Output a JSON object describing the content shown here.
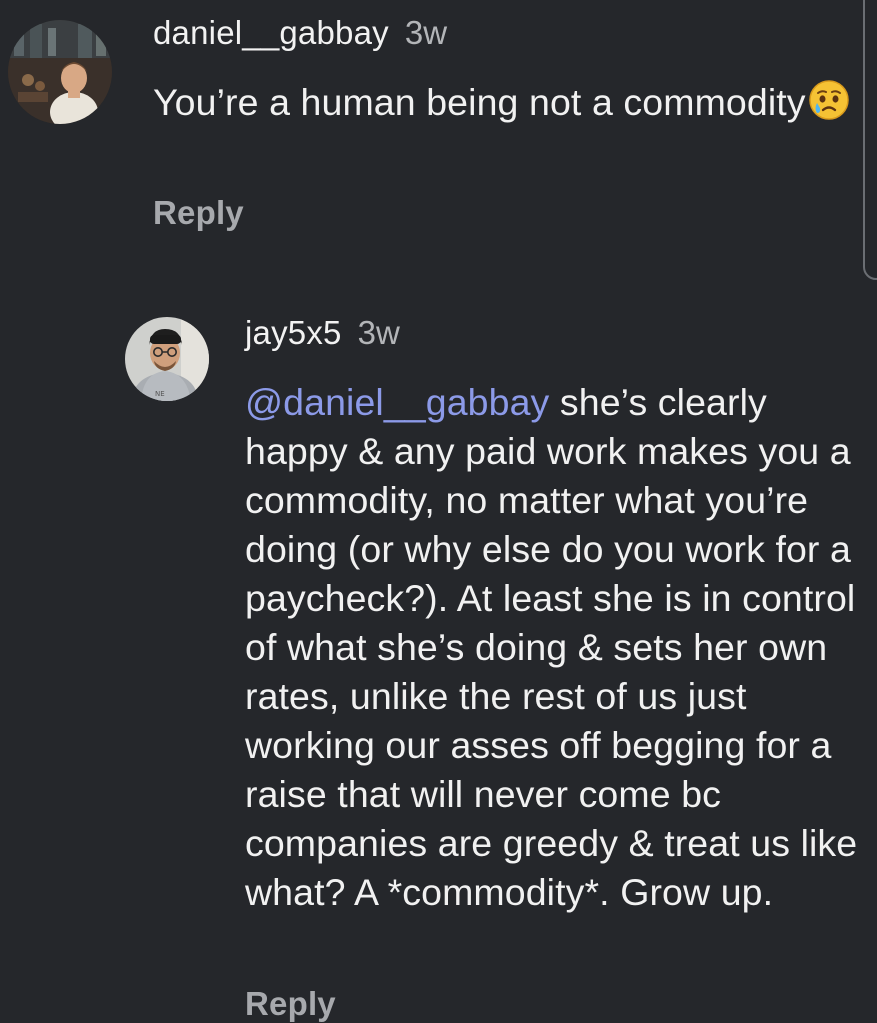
{
  "comments": [
    {
      "username": "daniel__gabbay",
      "time": "3w",
      "text": "You’re a human being not a commodity",
      "emoji": "crying-face",
      "reply_label": "Reply",
      "avatar": "avatar-photo"
    },
    {
      "username": "jay5x5",
      "time": "3w",
      "mention": "@daniel__gabbay",
      "text": " she’s clearly happy & any paid work makes you a commodity, no matter what you’re doing (or why else do you work for a paycheck?). At least she is in control of what she’s doing & sets her own rates, unlike the rest of us just working our asses off begging for a raise that will never come bc companies are greedy & treat us like what? A *commodity*. Grow up.",
      "reply_label": "Reply",
      "avatar": "avatar-photo"
    }
  ],
  "colors": {
    "background": "#25272b",
    "text": "#f1f1f1",
    "muted": "#b3b5b8",
    "mention": "#8c9ae8",
    "reply": "#a7a9ad"
  }
}
